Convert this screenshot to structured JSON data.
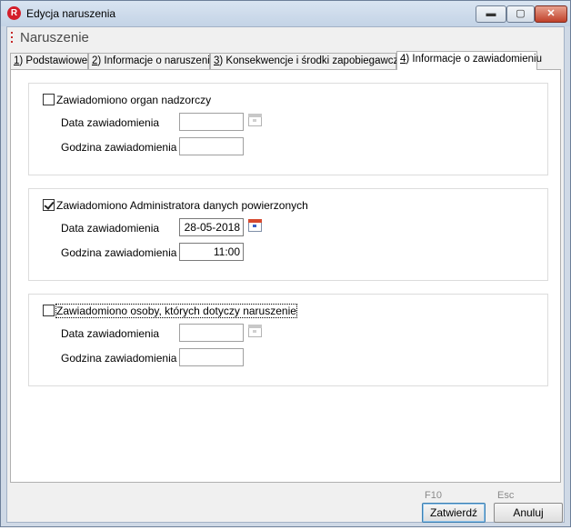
{
  "window": {
    "title": "Edycja naruszenia",
    "app_icon_letter": "R"
  },
  "header": {
    "title": "Naruszenie"
  },
  "tabs": [
    {
      "key": "1",
      "label": ") Podstawiowe"
    },
    {
      "key": "2",
      "label": ") Informacje o naruszeniu"
    },
    {
      "key": "3",
      "label": ") Konsekwencje i środki zapobiegawcze"
    },
    {
      "key": "4",
      "label": ") Informacje o zawiadomieniu"
    }
  ],
  "groups": [
    {
      "checkbox_label": "Zawiadomiono organ nadzorczy",
      "checked": false,
      "date_label": "Data zawiadomienia",
      "date_value": "",
      "time_label": "Godzina zawiadomienia",
      "time_value": ""
    },
    {
      "checkbox_label": "Zawiadomiono Administratora danych powierzonych",
      "checked": true,
      "date_label": "Data zawiadomienia",
      "date_value": "28-05-2018",
      "time_label": "Godzina zawiadomienia",
      "time_value": "11:00"
    },
    {
      "checkbox_label": "Zawiadomiono osoby, których dotyczy naruszenie",
      "checked": false,
      "date_label": "Data zawiadomienia",
      "date_value": "",
      "time_label": "Godzina zawiadomienia",
      "time_value": ""
    }
  ],
  "footer": {
    "confirm_shortcut": "F10",
    "confirm_label": "Zatwierdź",
    "cancel_shortcut": "Esc",
    "cancel_label": "Anuluj"
  },
  "icons": {
    "app": "app-logo-icon",
    "minimize": "minimize-icon",
    "maximize": "maximize-icon",
    "close": "close-icon",
    "calendar": "calendar-icon"
  },
  "colors": {
    "accent": "#d41e2a",
    "close_button": "#c0412a",
    "panel": "#ffffff"
  }
}
